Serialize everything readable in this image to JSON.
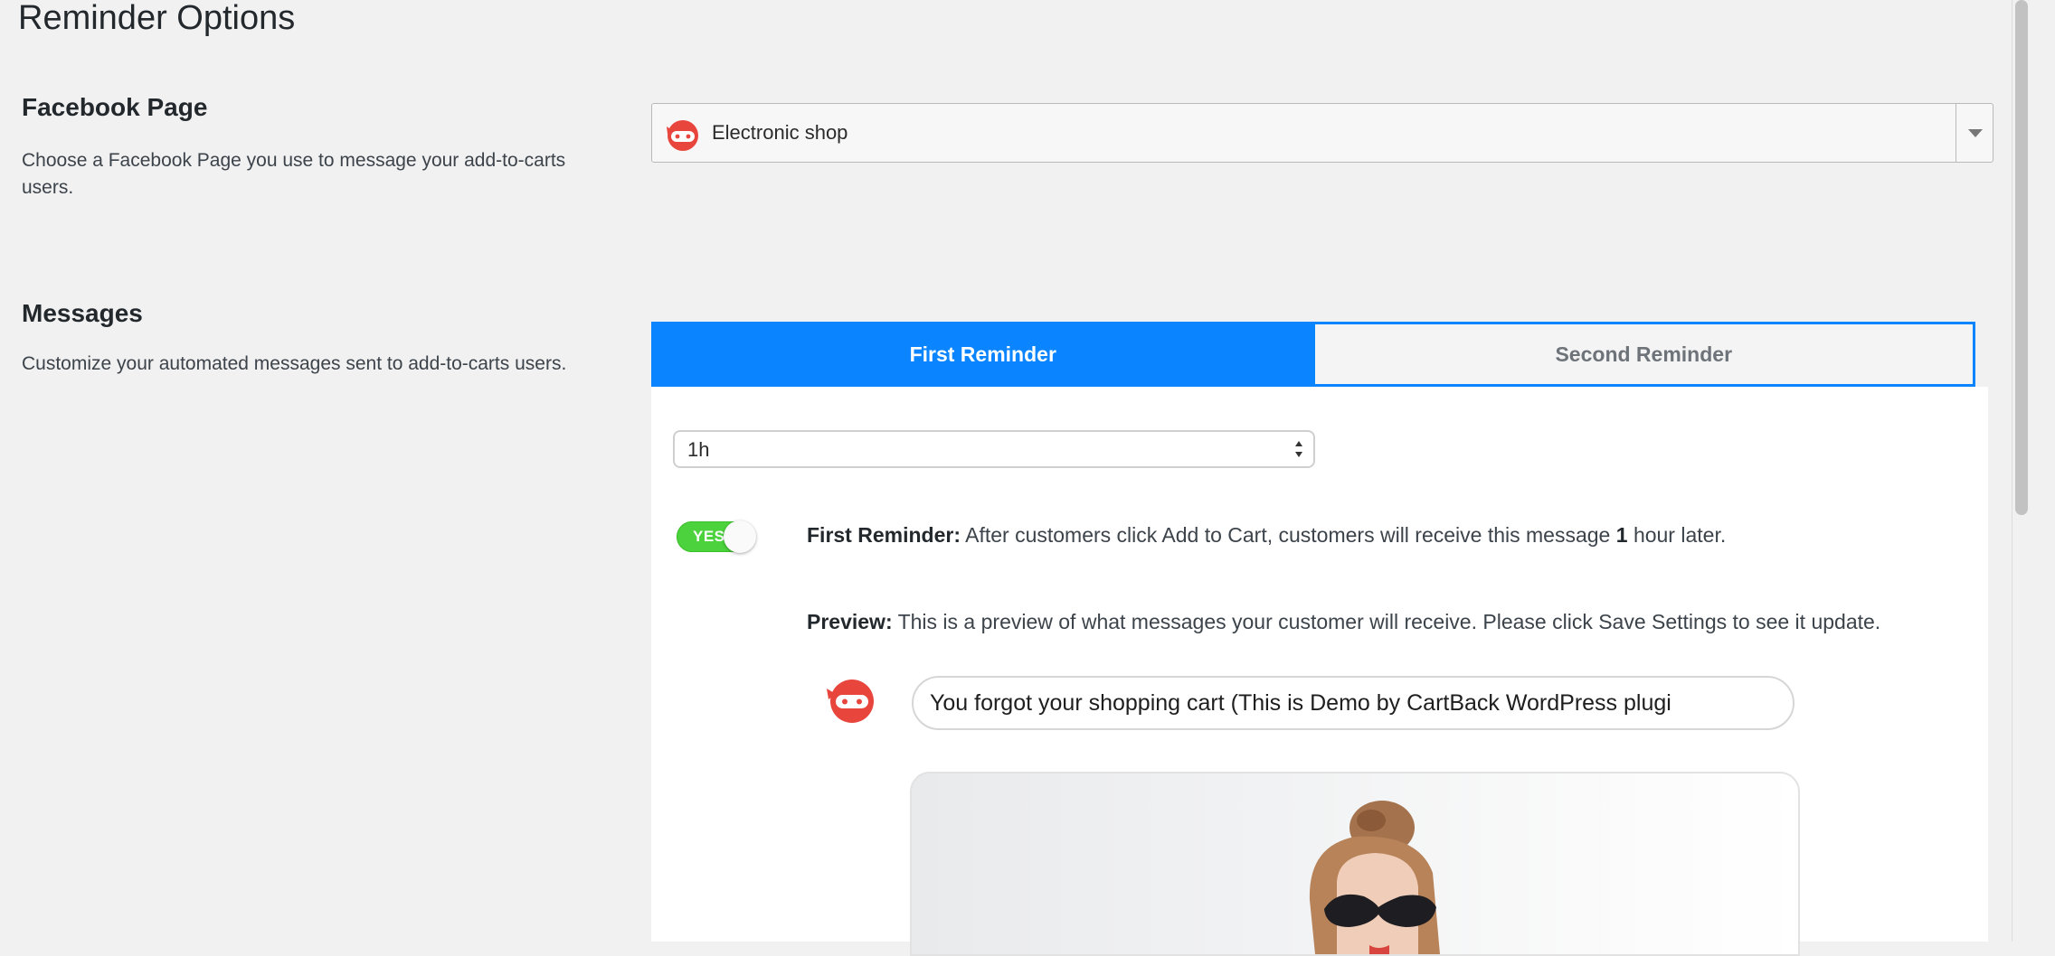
{
  "page": {
    "title": "Reminder Options"
  },
  "facebook_page": {
    "title": "Facebook Page",
    "description": "Choose a Facebook Page you use to message your add-to-carts users.",
    "selected": "Electronic shop"
  },
  "messages": {
    "title": "Messages",
    "description": "Customize your automated messages sent to add-to-carts users.",
    "tabs": [
      {
        "label": "First Reminder",
        "active": true
      },
      {
        "label": "Second Reminder",
        "active": false
      }
    ],
    "delay": {
      "value": "1h"
    },
    "toggle": {
      "label": "YES",
      "on": true
    },
    "reminder_info": {
      "label": "First Reminder:",
      "text_before": "After customers click Add to Cart, customers will receive this message",
      "hours": "1",
      "text_after": "hour later."
    },
    "preview": {
      "label": "Preview:",
      "text": "This is a preview of what messages your customer will receive. Please click Save Settings to see it update."
    },
    "message_text": "You forgot your shopping cart (This is Demo by CartBack WordPress plugi"
  },
  "colors": {
    "accent": "#0a84ff",
    "toggle_on": "#4cd23c",
    "brand_red": "#e8453c"
  }
}
